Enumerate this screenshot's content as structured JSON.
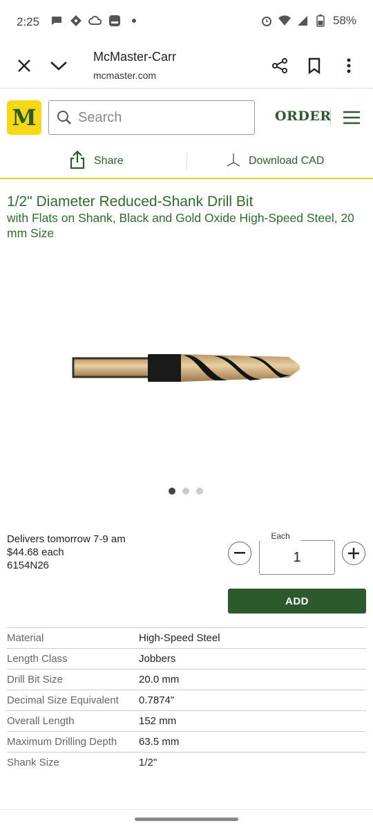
{
  "status_bar": {
    "time": "2:25",
    "battery": "58%"
  },
  "browser": {
    "title": "McMaster-Carr",
    "url": "mcmaster.com"
  },
  "header": {
    "logo_letter": "M",
    "search_placeholder": "Search",
    "order_label": "ORDER"
  },
  "actions": {
    "share_label": "Share",
    "cad_label": "Download CAD"
  },
  "product": {
    "title": "1/2\" Diameter Reduced-Shank Drill Bit",
    "subtitle": "with Flats on Shank, Black and Gold Oxide High-Speed Steel, 20 mm Size",
    "delivery": "Delivers tomorrow 7-9 am",
    "price": "$44.68 each",
    "part_number": "6154N26",
    "quantity_label": "Each",
    "quantity": "1",
    "add_label": "ADD",
    "image_count": 3,
    "active_image": 1
  },
  "specs": [
    {
      "label": "Material",
      "value": "High-Speed Steel"
    },
    {
      "label": "Length Class",
      "value": "Jobbers"
    },
    {
      "label": "Drill Bit Size",
      "value": "20.0 mm"
    },
    {
      "label": "Decimal Size Equivalent",
      "value": "0.7874\""
    },
    {
      "label": "Overall Length",
      "value": "152 mm"
    },
    {
      "label": "Maximum Drilling Depth",
      "value": "63.5 mm"
    },
    {
      "label": "Shank Size",
      "value": "1/2\""
    }
  ],
  "colors": {
    "brand_green": "#2c5a2c",
    "brand_yellow": "#f7d817",
    "title_green": "#2f6b2f"
  }
}
